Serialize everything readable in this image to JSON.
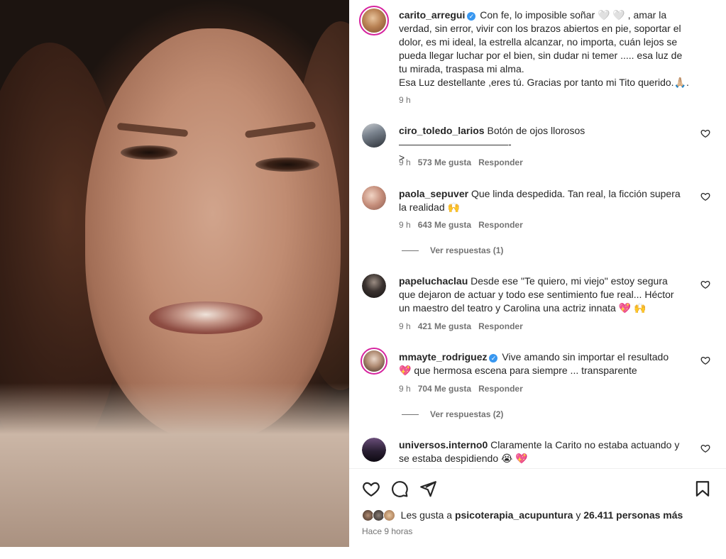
{
  "post": {
    "author": "carito_arregui",
    "caption_lines": [
      "Con fe, lo imposible soñar 🤍 🤍 , amar la",
      "verdad, sin error, vivir con los brazos abiertos en pie, soportar el",
      "dolor, es mi ideal, la estrella alcanzar, no importa, cuán lejos se",
      "pueda llegar luchar por el bien, sin dudar ni temer ..... esa luz de",
      "tu mirada, traspasa mi alma.",
      "Esa Luz destellante ,eres tú. Gracias por tanto mi Tito querido.🙏🏼."
    ],
    "time": "9 h"
  },
  "comments": [
    {
      "username": "ciro_toledo_larios",
      "verified": false,
      "lines": [
        "Botón de ojos llorosos ———————————-",
        ">"
      ],
      "time": "9 h",
      "likes": "573 Me gusta",
      "reply": "Responder"
    },
    {
      "username": "paola_sepuver",
      "verified": false,
      "lines": [
        "Que linda despedida. Tan real, la ficción supera",
        "la realidad 🙌"
      ],
      "time": "9 h",
      "likes": "643 Me gusta",
      "reply": "Responder",
      "view_replies": "Ver respuestas (1)"
    },
    {
      "username": "papeluchaclau",
      "verified": false,
      "lines": [
        "Desde ese \"Te quiero, mi viejo\" estoy segura",
        "que dejaron de actuar y todo ese sentimiento fue real... Héctor",
        "un maestro del teatro y Carolina una actriz innata 💖 🙌"
      ],
      "time": "9 h",
      "likes": "421 Me gusta",
      "reply": "Responder"
    },
    {
      "username": "mmayte_rodriguez",
      "verified": true,
      "lines": [
        "Vive amando sin importar el resultado",
        "💖 que hermosa escena para siempre ... transparente"
      ],
      "time": "9 h",
      "likes": "704 Me gusta",
      "reply": "Responder",
      "view_replies": "Ver respuestas (2)"
    },
    {
      "username": "universos.interno0",
      "verified": false,
      "lines": [
        "Claramente la Carito no estaba actuando y",
        "se estaba despidiendo 😭 💖"
      ]
    }
  ],
  "likes_summary": {
    "prefix": "Les gusta a",
    "user": "psicoterapia_acupuntura",
    "middle": "y",
    "others": "26.411 personas más"
  },
  "posted_ago": "Hace 9 horas",
  "colors": {
    "verified": "#3897f0",
    "story_ring": "#d6249f",
    "text": "#262626",
    "muted": "#737373"
  }
}
